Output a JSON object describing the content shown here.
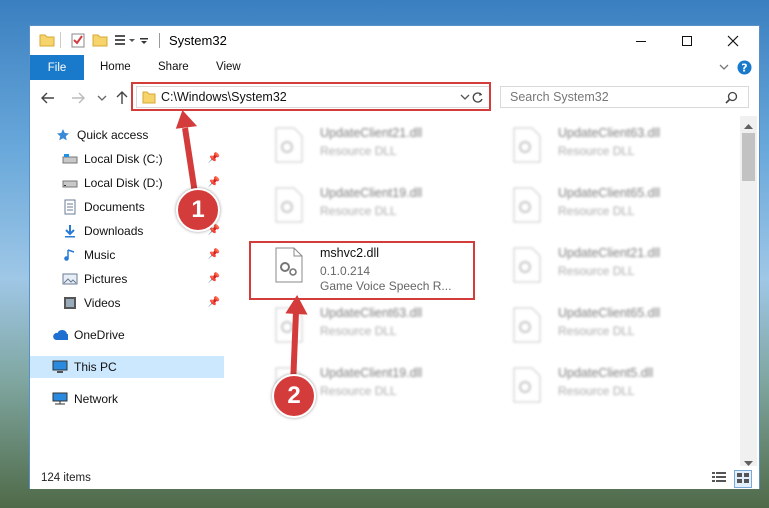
{
  "window": {
    "title": "System32"
  },
  "ribbon": {
    "file": "File",
    "home": "Home",
    "share": "Share",
    "view": "View"
  },
  "address": {
    "path": "C:\\Windows\\System32"
  },
  "search": {
    "placeholder": "Search System32"
  },
  "nav": {
    "items": [
      {
        "label": "Quick access",
        "icon": "star-icon"
      },
      {
        "label": "Local Disk (C:)",
        "icon": "drive-icon"
      },
      {
        "label": "Local Disk (D:)",
        "icon": "drive-icon"
      },
      {
        "label": "Documents",
        "icon": "document-icon"
      },
      {
        "label": "Downloads",
        "icon": "download-icon"
      },
      {
        "label": "Music",
        "icon": "music-icon"
      },
      {
        "label": "Pictures",
        "icon": "pictures-icon"
      },
      {
        "label": "Videos",
        "icon": "videos-icon"
      },
      {
        "label": "OneDrive",
        "icon": "cloud-icon"
      },
      {
        "label": "This PC",
        "icon": "computer-icon"
      },
      {
        "label": "Network",
        "icon": "network-icon"
      }
    ]
  },
  "files": {
    "left": [
      {
        "name": "UpdateClient21.dll",
        "type": "Resource DLL"
      },
      {
        "name": "UpdateClient19.dll",
        "type": "Resource DLL"
      },
      {
        "name": "mshvc2.dll",
        "version": "0.1.0.214",
        "description": "Game Voice Speech R..."
      },
      {
        "name": "UpdateClient63.dll",
        "type": "Resource DLL"
      },
      {
        "name": "UpdateClient19.dll",
        "type": "Resource DLL"
      }
    ],
    "right": [
      {
        "name": "UpdateClient63.dll",
        "type": "Resource DLL"
      },
      {
        "name": "UpdateClient65.dll",
        "type": "Resource DLL"
      },
      {
        "name": "UpdateClient21.dll",
        "type": "Resource DLL"
      },
      {
        "name": "UpdateClient65.dll",
        "type": "Resource DLL"
      },
      {
        "name": "UpdateClient5.dll",
        "type": "Resource DLL"
      }
    ]
  },
  "status": {
    "count": "124 items"
  },
  "callouts": {
    "one": "1",
    "two": "2"
  },
  "colors": {
    "accent": "#1979ca",
    "highlight": "#d43c3c",
    "selected": "#cce8ff"
  }
}
